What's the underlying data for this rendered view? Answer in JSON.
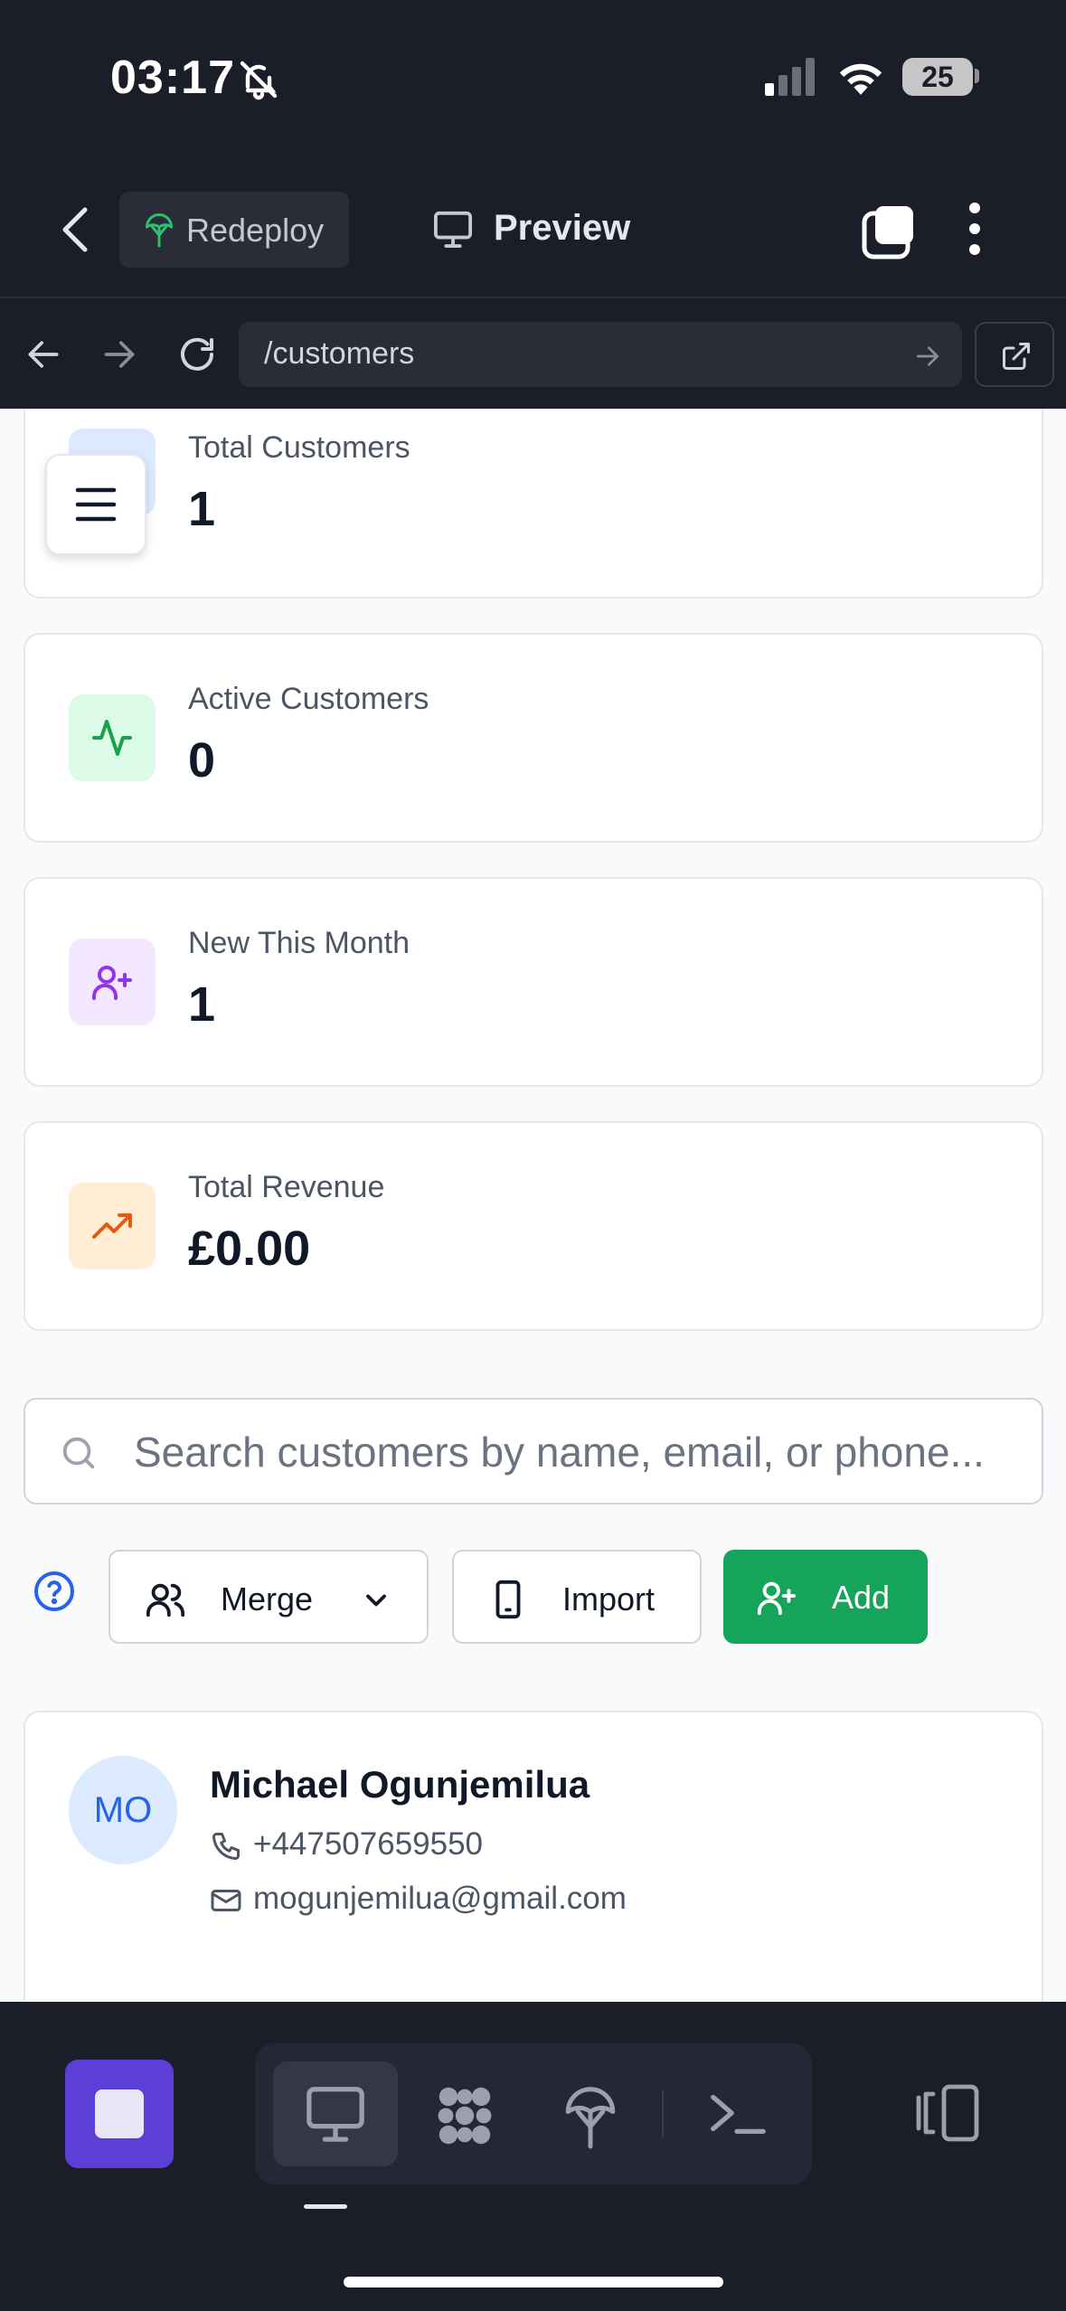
{
  "status_bar": {
    "time": "03:17",
    "battery": "25",
    "icons": [
      "bell-muted-icon",
      "cellular-signal-icon",
      "wifi-icon",
      "battery-icon"
    ]
  },
  "app_header": {
    "redeploy_label": "Redeploy",
    "preview_label": "Preview",
    "icons": [
      "back-chevron-icon",
      "deploy-icon",
      "monitor-icon",
      "tabs-icon",
      "more-vertical-icon"
    ]
  },
  "url_bar": {
    "path": "/customers",
    "icons": [
      "arrow-left-icon",
      "arrow-right-icon",
      "reload-icon",
      "go-arrow-icon",
      "external-link-icon"
    ]
  },
  "stats": [
    {
      "label": "Total Customers",
      "value": "1",
      "icon": "users-icon",
      "color": "#dbeafe"
    },
    {
      "label": "Active Customers",
      "value": "0",
      "icon": "activity-icon",
      "color": "#dcfce7"
    },
    {
      "label": "New This Month",
      "value": "1",
      "icon": "user-plus-icon",
      "color": "#f3e8ff"
    },
    {
      "label": "Total Revenue",
      "value": "£0.00",
      "icon": "trending-up-icon",
      "color": "#ffedd5"
    }
  ],
  "search": {
    "placeholder": "Search customers by name, email, or phone..."
  },
  "actions": {
    "merge_label": "Merge",
    "import_label": "Import",
    "add_label": "Add",
    "add_color": "#16a35a"
  },
  "customers": [
    {
      "initials": "MO",
      "name": "Michael Ogunjemilua",
      "phone": "+447507659550",
      "email": "mogunjemilua@gmail.com"
    }
  ],
  "bottom_bar": {
    "accent": "#5b3fd6",
    "tools": [
      "monitor-icon",
      "apps-icon",
      "deploy-icon",
      "terminal-icon"
    ],
    "active_tool": "monitor-icon"
  }
}
